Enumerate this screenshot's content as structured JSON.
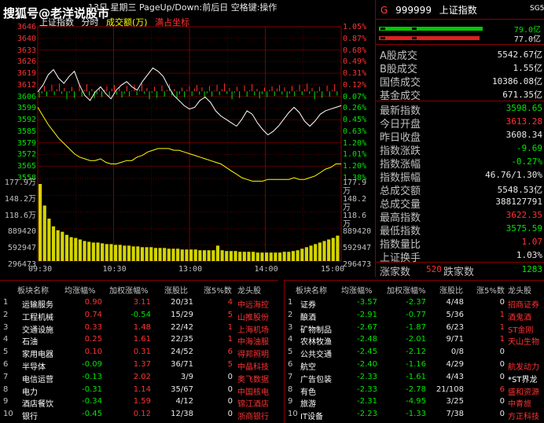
{
  "watermark": "搜狐号@老洋说股市",
  "top_strip": "13日 星期三 PageUp/Down:前后日 空格键:操作",
  "chart_header": {
    "name": "上证指数",
    "mode": "分时",
    "volume_label": "成交额(万)",
    "coord_label": "满占坐标"
  },
  "price_axis": {
    "left": [
      "3646",
      "3640",
      "3633",
      "3626",
      "3619",
      "3612",
      "3606",
      "3599",
      "3592",
      "3585",
      "3579",
      "3572",
      "3565",
      "3558"
    ],
    "right": [
      "1.05%",
      "0.87%",
      "0.68%",
      "0.49%",
      "0.31%",
      "0.12%",
      "0.07%",
      "0.26%",
      "0.45%",
      "0.63%",
      "1.20%",
      "1.01%",
      "1.20%",
      "1.38%"
    ],
    "min": 3558,
    "max": 3646,
    "prev_close": 3608.34
  },
  "volume_axis": {
    "left": [
      "177.9万",
      "148.2万",
      "118.6万",
      "889420",
      "592947",
      "296473"
    ],
    "right": [
      "177.9万",
      "148.2万",
      "118.6万",
      "889420",
      "592947",
      "296473"
    ]
  },
  "time_axis": [
    "09:30",
    "10:30",
    "13:00",
    "14:00",
    "15:00"
  ],
  "chart_data": {
    "type": "line",
    "x_label": "时间",
    "series": [
      {
        "name": "",
        "color": "#ffffff",
        "values": [
          3608,
          3612,
          3618,
          3621,
          3616,
          3613,
          3617,
          3620,
          3612,
          3606,
          3603,
          3608,
          3611,
          3607,
          3604,
          3609,
          3612,
          3614,
          3611,
          3609,
          3614,
          3618,
          3622,
          3620,
          3617,
          3611,
          3606,
          3603,
          3600,
          3598,
          3599,
          3603,
          3605,
          3602,
          3597,
          3594,
          3592,
          3590,
          3588,
          3592,
          3597,
          3595,
          3590,
          3586,
          3583,
          3585,
          3588,
          3592,
          3596,
          3599,
          3596,
          3591,
          3588,
          3591,
          3595,
          3597,
          3598,
          3599,
          3600
        ]
      },
      {
        "name": "",
        "color": "#ffff00",
        "values": [
          3599,
          3594,
          3589,
          3585,
          3581,
          3578,
          3575,
          3572,
          3570,
          3569,
          3568,
          3568,
          3569,
          3567,
          3566,
          3566,
          3567,
          3568,
          3568,
          3570,
          3571,
          3573,
          3574,
          3575,
          3575,
          3575,
          3574,
          3574,
          3573,
          3572,
          3571,
          3570,
          3569,
          3568,
          3567,
          3566,
          3564,
          3562,
          3560,
          3558,
          3557,
          3556,
          3556,
          3556,
          3557,
          3557,
          3557,
          3557,
          3557,
          3558,
          3557,
          3557,
          3558,
          3559,
          3561,
          3563,
          3564,
          3566,
          3566
        ]
      }
    ],
    "volume_bars": [
      100,
      72,
      55,
      45,
      40,
      38,
      34,
      31,
      30,
      28,
      26,
      25,
      24,
      24,
      23,
      22,
      22,
      21,
      21,
      20,
      20,
      19,
      19,
      18,
      18,
      18,
      17,
      17,
      17,
      16,
      16,
      16,
      15,
      15,
      15,
      15,
      14,
      14,
      14,
      14,
      20,
      14,
      13,
      13,
      13,
      12,
      12,
      12,
      12,
      11,
      11,
      11,
      11,
      11,
      11,
      12,
      12,
      13,
      14,
      16,
      18,
      20,
      22,
      24,
      26,
      28,
      30,
      33
    ],
    "ylim": [
      3558,
      3646
    ]
  },
  "info": {
    "marker": "G",
    "code": "999999",
    "name": "上证指数",
    "badge": "SG5",
    "bar1_val": "79.0亿",
    "bar2_val": "77.0亿",
    "rows1": [
      {
        "label": "A股成交",
        "value": "5542.67亿",
        "color": "#e8e8e8"
      },
      {
        "label": "B股成交",
        "value": "1.55亿",
        "color": "#e8e8e8"
      },
      {
        "label": "国债成交",
        "value": "10386.08亿",
        "color": "#e8e8e8"
      },
      {
        "label": "基金成交",
        "value": "671.35亿",
        "color": "#e8e8e8"
      }
    ],
    "rows2": [
      {
        "label": "最新指数",
        "value": "3598.65",
        "color": "#00e600"
      },
      {
        "label": "今日开盘",
        "value": "3613.28",
        "color": "#ff3232"
      },
      {
        "label": "昨日收盘",
        "value": "3608.34",
        "color": "#e8e8e8"
      },
      {
        "label": "指数涨跌",
        "value": "-9.69",
        "color": "#00e600"
      },
      {
        "label": "指数涨幅",
        "value": "-0.27%",
        "color": "#00e600"
      },
      {
        "label": "指数振幅",
        "value": "46.76/1.30%",
        "color": "#e8e8e8"
      },
      {
        "label": "总成交额",
        "value": "5548.53亿",
        "color": "#e8e8e8"
      },
      {
        "label": "总成交量",
        "value": "388127791",
        "color": "#e8e8e8"
      },
      {
        "label": "最高指数",
        "value": "3622.35",
        "color": "#ff3232"
      },
      {
        "label": "最低指数",
        "value": "3575.59",
        "color": "#00e600"
      },
      {
        "label": "指数量比",
        "value": "1.07",
        "color": "#ff3232"
      },
      {
        "label": "上证换手",
        "value": "1.03%",
        "color": "#e8e8e8"
      }
    ],
    "up_label": "涨家数",
    "up_value": "520",
    "down_label": "跌家数",
    "down_value": "1283"
  },
  "headers": [
    "板块名称",
    "均涨幅%",
    "加权涨幅%",
    "涨股比",
    "涨5%数",
    "龙头股"
  ],
  "left_table": [
    {
      "n": "1",
      "name": "运输服务",
      "avg": "0.90",
      "wavg": "3.11",
      "ratio": "20/31",
      "cnt": "4",
      "lead": "中远海控",
      "avgc": "red",
      "wc": "red",
      "lc": "red"
    },
    {
      "n": "2",
      "name": "工程机械",
      "avg": "0.74",
      "wavg": "-0.54",
      "ratio": "15/29",
      "cnt": "5",
      "lead": "山推股份",
      "avgc": "red",
      "wc": "green",
      "lc": "red"
    },
    {
      "n": "3",
      "name": "交通设施",
      "avg": "0.33",
      "wavg": "1.48",
      "ratio": "22/42",
      "cnt": "1",
      "lead": "上海机场",
      "avgc": "red",
      "wc": "red",
      "lc": "red"
    },
    {
      "n": "4",
      "name": "石油",
      "avg": "0.25",
      "wavg": "1.61",
      "ratio": "22/35",
      "cnt": "1",
      "lead": "中海油服",
      "avgc": "red",
      "wc": "red",
      "lc": "red"
    },
    {
      "n": "5",
      "name": "家用电器",
      "avg": "0.10",
      "wavg": "0.31",
      "ratio": "24/52",
      "cnt": "6",
      "lead": "得邦照明",
      "avgc": "red",
      "wc": "red",
      "lc": "red"
    },
    {
      "n": "6",
      "name": "半导体",
      "avg": "-0.09",
      "wavg": "1.37",
      "ratio": "36/71",
      "cnt": "5",
      "lead": "中晶科技",
      "avgc": "green",
      "wc": "red",
      "lc": "red"
    },
    {
      "n": "7",
      "name": "电信运营",
      "avg": "-0.13",
      "wavg": "2.02",
      "ratio": "3/9",
      "cnt": "0",
      "lead": "奥飞数据",
      "avgc": "green",
      "wc": "red",
      "lc": "red"
    },
    {
      "n": "8",
      "name": "电力",
      "avg": "-0.31",
      "wavg": "1.14",
      "ratio": "35/67",
      "cnt": "0",
      "lead": "中国核电",
      "avgc": "green",
      "wc": "red",
      "lc": "red"
    },
    {
      "n": "9",
      "name": "酒店餐饮",
      "avg": "-0.34",
      "wavg": "1.59",
      "ratio": "4/12",
      "cnt": "0",
      "lead": "锦江酒店",
      "avgc": "green",
      "wc": "red",
      "lc": "red"
    },
    {
      "n": "10",
      "name": "银行",
      "avg": "-0.45",
      "wavg": "0.12",
      "ratio": "12/38",
      "cnt": "0",
      "lead": "浙商银行",
      "avgc": "green",
      "wc": "red",
      "lc": "red"
    }
  ],
  "right_table": [
    {
      "n": "1",
      "name": "证券",
      "avg": "-3.57",
      "wavg": "-2.37",
      "ratio": "4/48",
      "cnt": "0",
      "lead": "招商证券",
      "lc": "red"
    },
    {
      "n": "2",
      "name": "酿酒",
      "avg": "-2.91",
      "wavg": "-0.77",
      "ratio": "5/36",
      "cnt": "1",
      "lead": "酒鬼酒",
      "lc": "red"
    },
    {
      "n": "3",
      "name": "矿物制品",
      "avg": "-2.67",
      "wavg": "-1.87",
      "ratio": "6/23",
      "cnt": "1",
      "lead": "ST金刚",
      "lc": "red"
    },
    {
      "n": "4",
      "name": "农林牧渔",
      "avg": "-2.48",
      "wavg": "-2.01",
      "ratio": "9/71",
      "cnt": "1",
      "lead": "天山生物",
      "lc": "red"
    },
    {
      "n": "5",
      "name": "公共交通",
      "avg": "-2.45",
      "wavg": "-2.12",
      "ratio": "0/8",
      "cnt": "0",
      "lead": "",
      "lc": "red"
    },
    {
      "n": "6",
      "name": "航空",
      "avg": "-2.40",
      "wavg": "-1.16",
      "ratio": "4/29",
      "cnt": "0",
      "lead": "航发动力",
      "lc": "red"
    },
    {
      "n": "7",
      "name": "广告包装",
      "avg": "-2.33",
      "wavg": "-1.61",
      "ratio": "4/43",
      "cnt": "0",
      "lead": "*ST界龙",
      "lc": "white"
    },
    {
      "n": "8",
      "name": "有色",
      "avg": "-2.33",
      "wavg": "-2.78",
      "ratio": "21/108",
      "cnt": "6",
      "lead": "盛和资源",
      "lc": "red"
    },
    {
      "n": "9",
      "name": "旅游",
      "avg": "-2.31",
      "wavg": "-4.95",
      "ratio": "3/25",
      "cnt": "0",
      "lead": "中青旅",
      "lc": "red"
    },
    {
      "n": "10",
      "name": "IT设备",
      "avg": "-2.23",
      "wavg": "-1.33",
      "ratio": "7/38",
      "cnt": "0",
      "lead": "方正科技",
      "lc": "red"
    }
  ]
}
